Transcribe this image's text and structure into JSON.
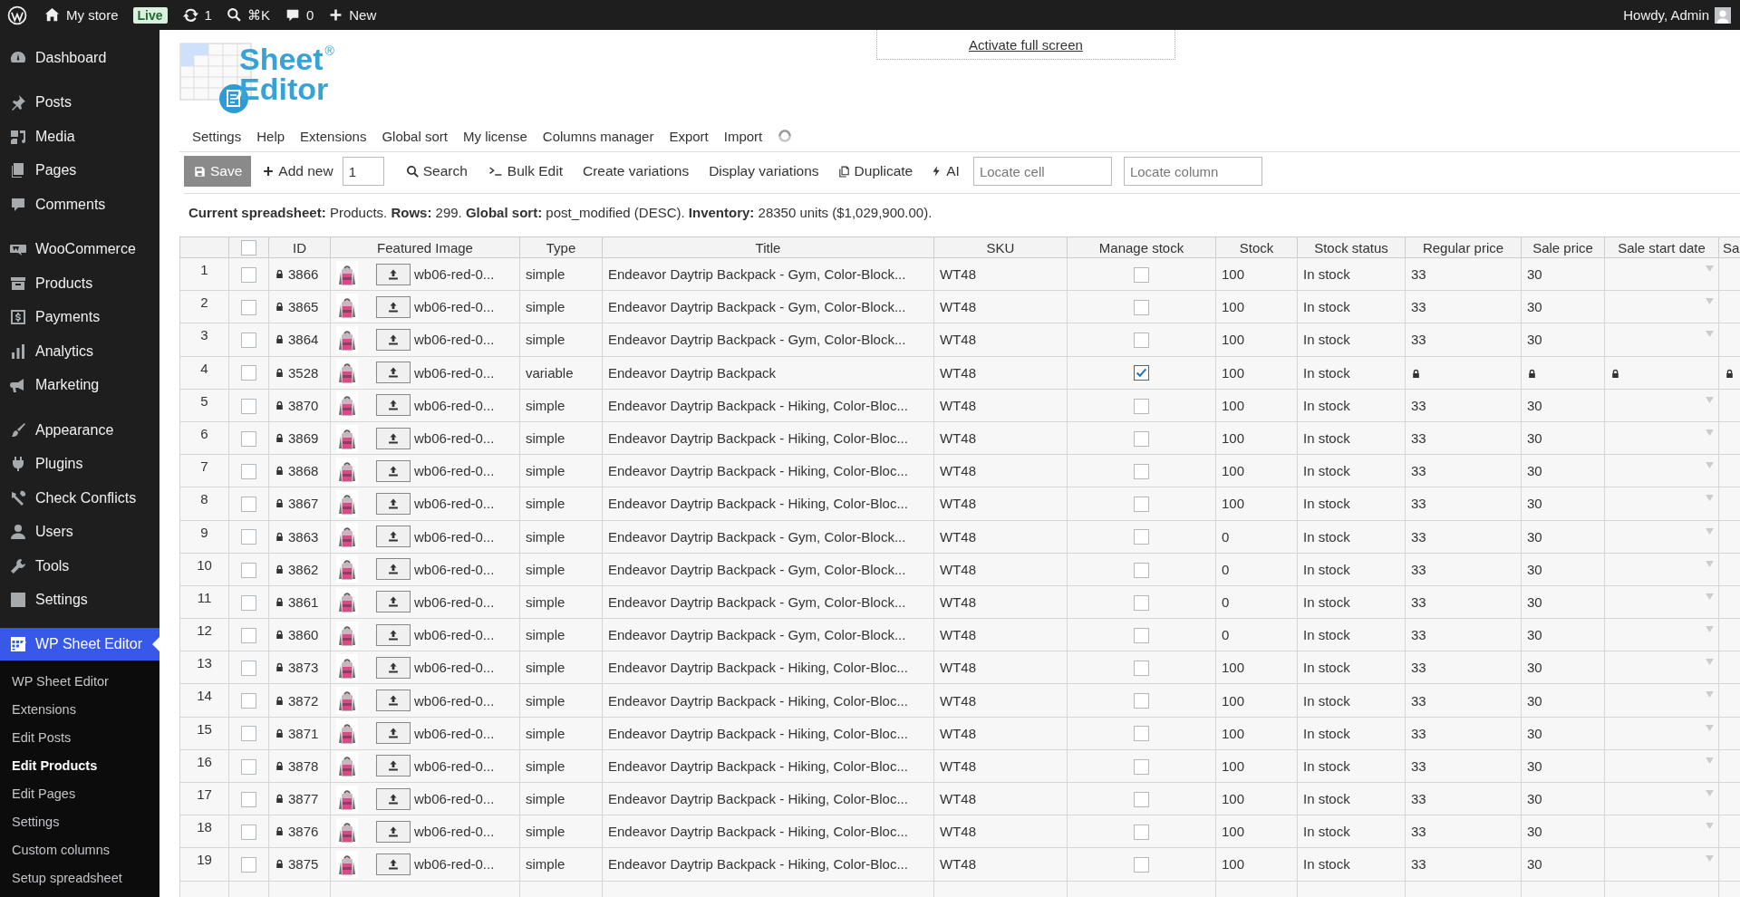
{
  "admin_bar": {
    "site": "My store",
    "badge": "Live",
    "updates": "1",
    "shortcut": "⌘K",
    "comments": "0",
    "new": "New",
    "greeting": "Howdy, Admin"
  },
  "sidebar": {
    "groups": [
      {
        "items": [
          {
            "label": "Dashboard",
            "selected": false
          }
        ]
      },
      {
        "items": [
          {
            "label": "Posts",
            "selected": false
          },
          {
            "label": "Media",
            "selected": false
          },
          {
            "label": "Pages",
            "selected": false
          },
          {
            "label": "Comments",
            "selected": false
          }
        ]
      },
      {
        "items": [
          {
            "label": "WooCommerce",
            "selected": false
          },
          {
            "label": "Products",
            "selected": false
          },
          {
            "label": "Payments",
            "selected": false
          },
          {
            "label": "Analytics",
            "selected": false
          },
          {
            "label": "Marketing",
            "selected": false
          }
        ]
      },
      {
        "items": [
          {
            "label": "Appearance",
            "selected": false
          },
          {
            "label": "Plugins",
            "selected": false
          },
          {
            "label": "Check Conflicts",
            "selected": false
          },
          {
            "label": "Users",
            "selected": false
          },
          {
            "label": "Tools",
            "selected": false
          },
          {
            "label": "Settings",
            "selected": false
          }
        ]
      },
      {
        "items": [
          {
            "label": "WP Sheet Editor",
            "selected": true,
            "children": [
              {
                "label": "WP Sheet Editor",
                "selected": false
              },
              {
                "label": "Extensions",
                "selected": false
              },
              {
                "label": "Edit Posts",
                "selected": false
              },
              {
                "label": "Edit Products",
                "selected": true
              },
              {
                "label": "Edit Pages",
                "selected": false
              },
              {
                "label": "Settings",
                "selected": false
              },
              {
                "label": "Custom columns",
                "selected": false
              },
              {
                "label": "Setup spreadsheet",
                "selected": false
              }
            ]
          }
        ]
      }
    ]
  },
  "header": {
    "logo": {
      "lines": [
        "Sheet",
        "Editor"
      ],
      "mark": "®"
    },
    "fullscreen_link": "Activate full screen",
    "menu": [
      "Settings",
      "Help",
      "Extensions",
      "Global sort",
      "My license",
      "Columns manager",
      "Export",
      "Import"
    ]
  },
  "toolbar": {
    "save": "Save",
    "add_new": "Add new",
    "add_count": "1",
    "search": "Search",
    "bulk_edit": "Bulk Edit",
    "create_variations": "Create variations",
    "display_variations": "Display variations",
    "duplicate": "Duplicate",
    "ai": "AI",
    "locate_cell": {
      "placeholder": "Locate cell"
    },
    "locate_column": {
      "placeholder": "Locate column"
    }
  },
  "info": "**Current spreadsheet:** Products. **Rows:** 299. **Global sort:** post_modified (DESC). **Inventory:** 28350 units ($1,029,900.00).",
  "table": {
    "select_all": {
      "checked": false
    },
    "columns": [
      "ID",
      "Featured Image",
      "Type",
      "Title",
      "SKU",
      "Manage stock",
      "Stock",
      "Stock status",
      "Regular price",
      "Sale price",
      "Sale start date",
      "Sa"
    ],
    "rows": [
      {
        "number": "1",
        "checked": false,
        "id": "3866",
        "image_file": "wb06-red-0...",
        "type": "simple",
        "title": "Endeavor Daytrip Backpack - Gym, Color-Block...",
        "sku": "WT48",
        "manage_stock": false,
        "stock": "100",
        "stock_status": "In stock",
        "regular_price": "33",
        "sale_price": "30",
        "prices_locked": false
      },
      {
        "number": "2",
        "checked": false,
        "id": "3865",
        "image_file": "wb06-red-0...",
        "type": "simple",
        "title": "Endeavor Daytrip Backpack - Gym, Color-Block...",
        "sku": "WT48",
        "manage_stock": false,
        "stock": "100",
        "stock_status": "In stock",
        "regular_price": "33",
        "sale_price": "30",
        "prices_locked": false
      },
      {
        "number": "3",
        "checked": false,
        "id": "3864",
        "image_file": "wb06-red-0...",
        "type": "simple",
        "title": "Endeavor Daytrip Backpack - Gym, Color-Block...",
        "sku": "WT48",
        "manage_stock": false,
        "stock": "100",
        "stock_status": "In stock",
        "regular_price": "33",
        "sale_price": "30",
        "prices_locked": false
      },
      {
        "number": "4",
        "checked": false,
        "id": "3528",
        "image_file": "wb06-red-0...",
        "type": "variable",
        "title": "Endeavor Daytrip Backpack",
        "sku": "WT48",
        "manage_stock": true,
        "stock": "100",
        "stock_status": "In stock",
        "prices_locked": true
      },
      {
        "number": "5",
        "checked": false,
        "id": "3870",
        "image_file": "wb06-red-0...",
        "type": "simple",
        "title": "Endeavor Daytrip Backpack - Hiking, Color-Bloc...",
        "sku": "WT48",
        "manage_stock": false,
        "stock": "100",
        "stock_status": "In stock",
        "regular_price": "33",
        "sale_price": "30",
        "prices_locked": false
      },
      {
        "number": "6",
        "checked": false,
        "id": "3869",
        "image_file": "wb06-red-0...",
        "type": "simple",
        "title": "Endeavor Daytrip Backpack - Hiking, Color-Bloc...",
        "sku": "WT48",
        "manage_stock": false,
        "stock": "100",
        "stock_status": "In stock",
        "regular_price": "33",
        "sale_price": "30",
        "prices_locked": false
      },
      {
        "number": "7",
        "checked": false,
        "id": "3868",
        "image_file": "wb06-red-0...",
        "type": "simple",
        "title": "Endeavor Daytrip Backpack - Hiking, Color-Bloc...",
        "sku": "WT48",
        "manage_stock": false,
        "stock": "100",
        "stock_status": "In stock",
        "regular_price": "33",
        "sale_price": "30",
        "prices_locked": false
      },
      {
        "number": "8",
        "checked": false,
        "id": "3867",
        "image_file": "wb06-red-0...",
        "type": "simple",
        "title": "Endeavor Daytrip Backpack - Hiking, Color-Bloc...",
        "sku": "WT48",
        "manage_stock": false,
        "stock": "100",
        "stock_status": "In stock",
        "regular_price": "33",
        "sale_price": "30",
        "prices_locked": false
      },
      {
        "number": "9",
        "checked": false,
        "id": "3863",
        "image_file": "wb06-red-0...",
        "type": "simple",
        "title": "Endeavor Daytrip Backpack - Gym, Color-Block...",
        "sku": "WT48",
        "manage_stock": false,
        "stock": "0",
        "stock_status": "In stock",
        "regular_price": "33",
        "sale_price": "30",
        "prices_locked": false
      },
      {
        "number": "10",
        "checked": false,
        "id": "3862",
        "image_file": "wb06-red-0...",
        "type": "simple",
        "title": "Endeavor Daytrip Backpack - Gym, Color-Block...",
        "sku": "WT48",
        "manage_stock": false,
        "stock": "0",
        "stock_status": "In stock",
        "regular_price": "33",
        "sale_price": "30",
        "prices_locked": false
      },
      {
        "number": "11",
        "checked": false,
        "id": "3861",
        "image_file": "wb06-red-0...",
        "type": "simple",
        "title": "Endeavor Daytrip Backpack - Gym, Color-Block...",
        "sku": "WT48",
        "manage_stock": false,
        "stock": "0",
        "stock_status": "In stock",
        "regular_price": "33",
        "sale_price": "30",
        "prices_locked": false
      },
      {
        "number": "12",
        "checked": false,
        "id": "3860",
        "image_file": "wb06-red-0...",
        "type": "simple",
        "title": "Endeavor Daytrip Backpack - Gym, Color-Block...",
        "sku": "WT48",
        "manage_stock": false,
        "stock": "0",
        "stock_status": "In stock",
        "regular_price": "33",
        "sale_price": "30",
        "prices_locked": false
      },
      {
        "number": "13",
        "checked": false,
        "id": "3873",
        "image_file": "wb06-red-0...",
        "type": "simple",
        "title": "Endeavor Daytrip Backpack - Hiking, Color-Bloc...",
        "sku": "WT48",
        "manage_stock": false,
        "stock": "100",
        "stock_status": "In stock",
        "regular_price": "33",
        "sale_price": "30",
        "prices_locked": false
      },
      {
        "number": "14",
        "checked": false,
        "id": "3872",
        "image_file": "wb06-red-0...",
        "type": "simple",
        "title": "Endeavor Daytrip Backpack - Hiking, Color-Bloc...",
        "sku": "WT48",
        "manage_stock": false,
        "stock": "100",
        "stock_status": "In stock",
        "regular_price": "33",
        "sale_price": "30",
        "prices_locked": false
      },
      {
        "number": "15",
        "checked": false,
        "id": "3871",
        "image_file": "wb06-red-0...",
        "type": "simple",
        "title": "Endeavor Daytrip Backpack - Hiking, Color-Bloc...",
        "sku": "WT48",
        "manage_stock": false,
        "stock": "100",
        "stock_status": "In stock",
        "regular_price": "33",
        "sale_price": "30",
        "prices_locked": false
      },
      {
        "number": "16",
        "checked": false,
        "id": "3878",
        "image_file": "wb06-red-0...",
        "type": "simple",
        "title": "Endeavor Daytrip Backpack - Hiking, Color-Bloc...",
        "sku": "WT48",
        "manage_stock": false,
        "stock": "100",
        "stock_status": "In stock",
        "regular_price": "33",
        "sale_price": "30",
        "prices_locked": false
      },
      {
        "number": "17",
        "checked": false,
        "id": "3877",
        "image_file": "wb06-red-0...",
        "type": "simple",
        "title": "Endeavor Daytrip Backpack - Hiking, Color-Bloc...",
        "sku": "WT48",
        "manage_stock": false,
        "stock": "100",
        "stock_status": "In stock",
        "regular_price": "33",
        "sale_price": "30",
        "prices_locked": false
      },
      {
        "number": "18",
        "checked": false,
        "id": "3876",
        "image_file": "wb06-red-0...",
        "type": "simple",
        "title": "Endeavor Daytrip Backpack - Hiking, Color-Bloc...",
        "sku": "WT48",
        "manage_stock": false,
        "stock": "100",
        "stock_status": "In stock",
        "regular_price": "33",
        "sale_price": "30",
        "prices_locked": false
      },
      {
        "number": "19",
        "checked": false,
        "id": "3875",
        "image_file": "wb06-red-0...",
        "type": "simple",
        "title": "Endeavor Daytrip Backpack - Hiking, Color-Bloc...",
        "sku": "WT48",
        "manage_stock": false,
        "stock": "100",
        "stock_status": "In stock",
        "regular_price": "33",
        "sale_price": "30",
        "prices_locked": false
      }
    ]
  }
}
